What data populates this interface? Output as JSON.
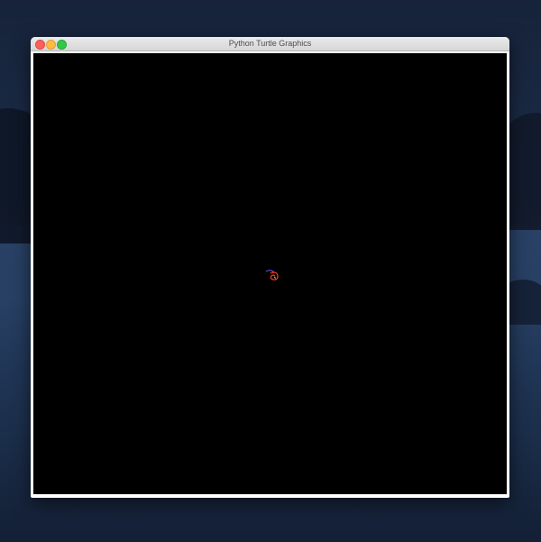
{
  "window": {
    "title": "Python Turtle Graphics"
  },
  "canvas": {
    "background": "#000000"
  },
  "drawing": {
    "colors": [
      "#ff3b1f",
      "#7a5cff",
      "#ffae00"
    ]
  },
  "icons": {
    "close": "close-traffic-light-icon",
    "minimize": "minimize-traffic-light-icon",
    "maximize": "maximize-traffic-light-icon"
  }
}
